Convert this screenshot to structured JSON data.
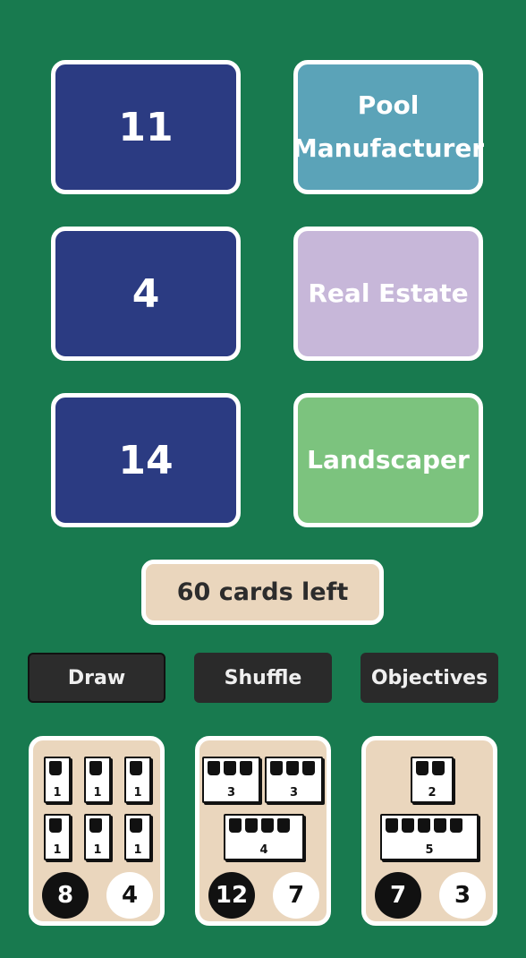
{
  "colors": {
    "table": "#187a4f",
    "number_card": "#2b3b82",
    "pool_manufacturer": "#5ba3b8",
    "real_estate": "#c7b7d9",
    "landscaper": "#7cc37e",
    "panel": "#ead6bd",
    "button": "#2a2a2a"
  },
  "rows": [
    {
      "number": "11",
      "effect": "Pool\nManufacturer",
      "effect_color": "#5ba3b8"
    },
    {
      "number": "4",
      "effect": "Real Estate",
      "effect_color": "#c7b7d9"
    },
    {
      "number": "14",
      "effect": "Landscaper",
      "effect_color": "#7cc37e"
    }
  ],
  "deck": {
    "remaining_label": "60 cards left"
  },
  "buttons": {
    "draw": "Draw",
    "shuffle": "Shuffle",
    "objectives": "Objectives"
  },
  "objectives": [
    {
      "estates": [
        [
          "1",
          "1",
          "1"
        ],
        [
          "1",
          "1",
          "1"
        ]
      ],
      "first_score": "8",
      "second_score": "4"
    },
    {
      "estates": [
        [
          "3",
          "3"
        ],
        [
          "4"
        ]
      ],
      "first_score": "12",
      "second_score": "7"
    },
    {
      "estates": [
        [
          "2"
        ],
        [
          "5"
        ]
      ],
      "first_score": "7",
      "second_score": "3"
    }
  ],
  "icons": {
    "house": "house-icon"
  }
}
